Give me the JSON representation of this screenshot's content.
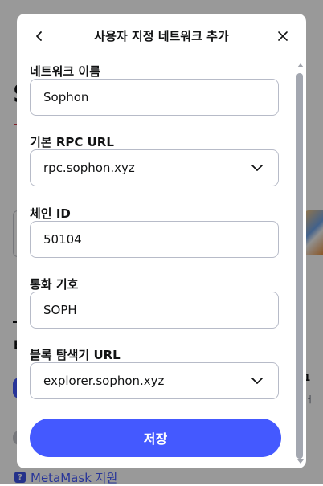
{
  "modal": {
    "title": "사용자 지정 네트워크 추가",
    "back_icon": "chevron-left-icon",
    "close_icon": "close-icon"
  },
  "fields": {
    "network_name": {
      "label": "네트워크 이름",
      "value": "Sophon"
    },
    "rpc_url": {
      "label": "기본 RPC URL",
      "value": "rpc.sophon.xyz"
    },
    "chain_id": {
      "label": "체인 ID",
      "value": "50104"
    },
    "currency_symbol": {
      "label": "통화 기호",
      "value": "SOPH"
    },
    "explorer_url": {
      "label": "블록 탐색기 URL",
      "value": "explorer.sophon.xyz"
    }
  },
  "footer": {
    "save_label": "저장"
  },
  "background": {
    "big_letter": "S",
    "section_letter": "B",
    "right_text_1": "1",
    "right_text_2": "ㅓ",
    "support_label": "MetaMask 지원"
  },
  "colors": {
    "primary": "#4459ff",
    "border": "#b7bbc8",
    "text": "#121314",
    "overlay": "rgba(0,0,0,0.40)"
  }
}
